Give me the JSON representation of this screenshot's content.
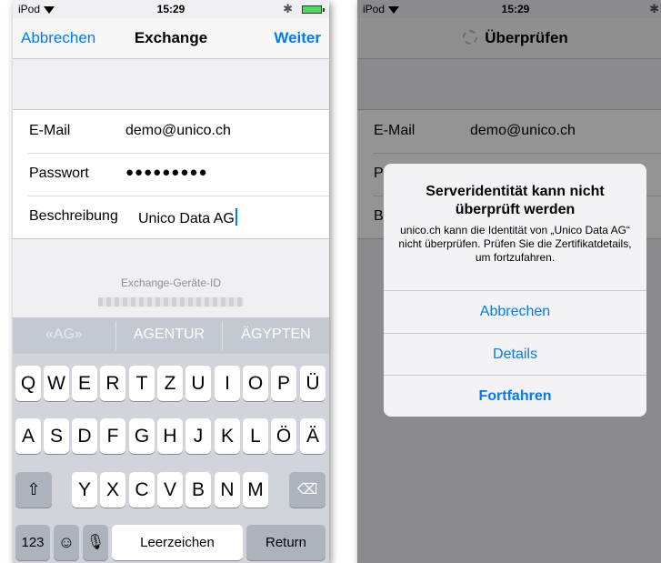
{
  "left_screen": {
    "status": {
      "carrier": "iPod",
      "time": "15:29"
    },
    "nav": {
      "cancel": "Abbrechen",
      "title": "Exchange",
      "next": "Weiter"
    },
    "fields": [
      {
        "label": "E-Mail",
        "value": "demo@unico.ch"
      },
      {
        "label": "Passwort",
        "value": "●●●●●●●●●"
      },
      {
        "label": "Beschreibung",
        "value": "Unico Data AG"
      }
    ],
    "device_id_label": "Exchange-Geräte-ID",
    "suggestions": [
      "«AG»",
      "AGENTUR",
      "ÄGYPTEN"
    ],
    "keyboard": {
      "row1": [
        "Q",
        "W",
        "E",
        "R",
        "T",
        "Z",
        "U",
        "I",
        "O",
        "P",
        "Ü"
      ],
      "row2": [
        "A",
        "S",
        "D",
        "F",
        "G",
        "H",
        "J",
        "K",
        "L",
        "Ö",
        "Ä"
      ],
      "row3": [
        "Y",
        "X",
        "C",
        "V",
        "B",
        "N",
        "M"
      ],
      "numbers": "123",
      "space": "Leerzeichen",
      "return": "Return"
    }
  },
  "right_screen": {
    "status": {
      "carrier": "iPod",
      "time": "15:29"
    },
    "nav_title": "Überprüfen",
    "fields": [
      {
        "label": "E-Mail",
        "value": "demo@unico.ch"
      },
      {
        "label": "P"
      },
      {
        "label": "B"
      }
    ],
    "alert": {
      "title": "Serveridentität kann nicht überprüft werden",
      "message": "unico.ch kann die Identität von „Unico Data AG“ nicht überprüfen. Prüfen Sie die Zertifikatdetails, um fortzufahren.",
      "buttons": [
        "Abbrechen",
        "Details",
        "Fortfahren"
      ]
    }
  },
  "colors": {
    "accent": "#007aff",
    "keyboard_bg": "#d1d4da",
    "fn_key": "#adb3bc"
  },
  "icons": [
    "wifi-icon",
    "bluetooth-icon",
    "battery-icon",
    "shift-icon",
    "backspace-icon",
    "emoji-icon",
    "microphone-icon",
    "spinner-icon"
  ]
}
